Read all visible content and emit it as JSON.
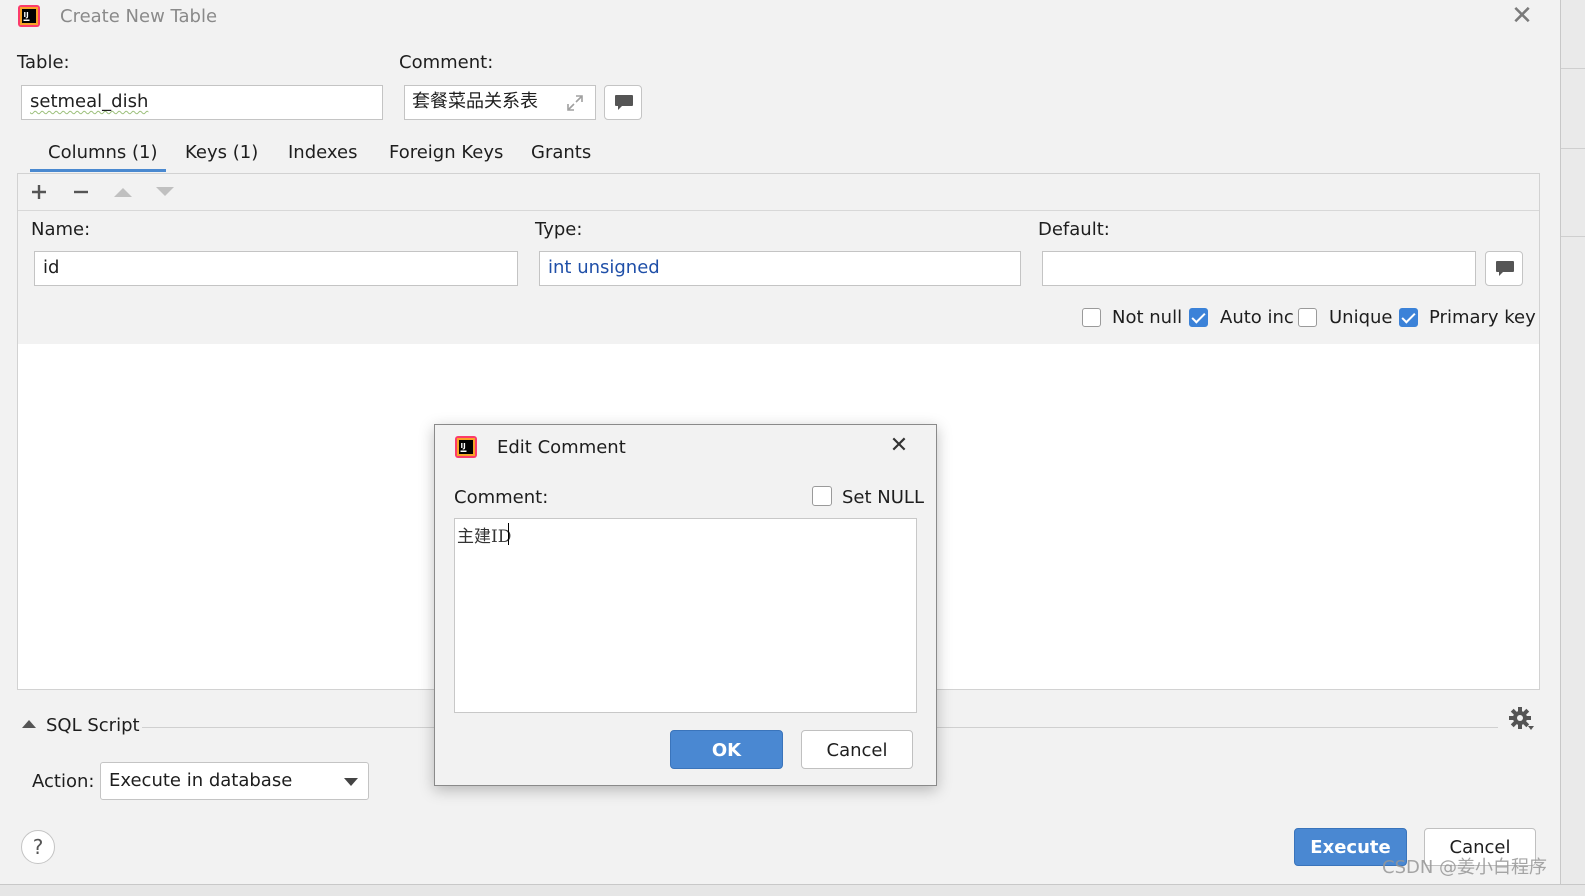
{
  "window": {
    "title": "Create New Table",
    "close_glyph": "✕"
  },
  "table_field": {
    "label": "Table:",
    "value": "setmeal_dish"
  },
  "comment_field": {
    "label": "Comment:",
    "value": "套餐菜品关系表"
  },
  "tabs": [
    {
      "label": "Columns (1)",
      "active": true
    },
    {
      "label": "Keys (1)",
      "active": false
    },
    {
      "label": "Indexes",
      "active": false
    },
    {
      "label": "Foreign Keys",
      "active": false
    },
    {
      "label": "Grants",
      "active": false
    }
  ],
  "toolbar": {
    "add": "+",
    "remove": "−",
    "move_up": "▲",
    "move_down": "▼"
  },
  "column_editor": {
    "name_label": "Name:",
    "name_value": "id",
    "type_label": "Type:",
    "type_value": "int unsigned",
    "default_label": "Default:",
    "default_value": ""
  },
  "options": [
    {
      "label": "Not null",
      "checked": false
    },
    {
      "label": "Auto inc",
      "checked": true
    },
    {
      "label": "Unique",
      "checked": false
    },
    {
      "label": "Primary key",
      "checked": true
    }
  ],
  "sql_script": {
    "label": "SQL Script"
  },
  "action": {
    "label": "Action:",
    "value": "Execute in database"
  },
  "help_glyph": "?",
  "buttons": {
    "execute": "Execute",
    "cancel": "Cancel"
  },
  "dialog": {
    "title": "Edit Comment",
    "comment_label": "Comment:",
    "set_null_label": "Set NULL",
    "set_null_checked": false,
    "text": "主建ID",
    "ok": "OK",
    "cancel": "Cancel",
    "close_glyph": "✕"
  },
  "watermark": "CSDN @姜小白程序",
  "colors": {
    "accent": "#4a88d2",
    "type_text": "#1f4fa8",
    "checkbox_on": "#3b82d8"
  },
  "icons": [
    "intellij-logo-icon",
    "expand-icon",
    "comment-icon",
    "plus-icon",
    "minus-icon",
    "arrow-up-icon",
    "arrow-down-icon",
    "collapse-triangle-icon",
    "gear-icon",
    "dropdown-arrow-icon",
    "help-icon",
    "close-icon"
  ]
}
